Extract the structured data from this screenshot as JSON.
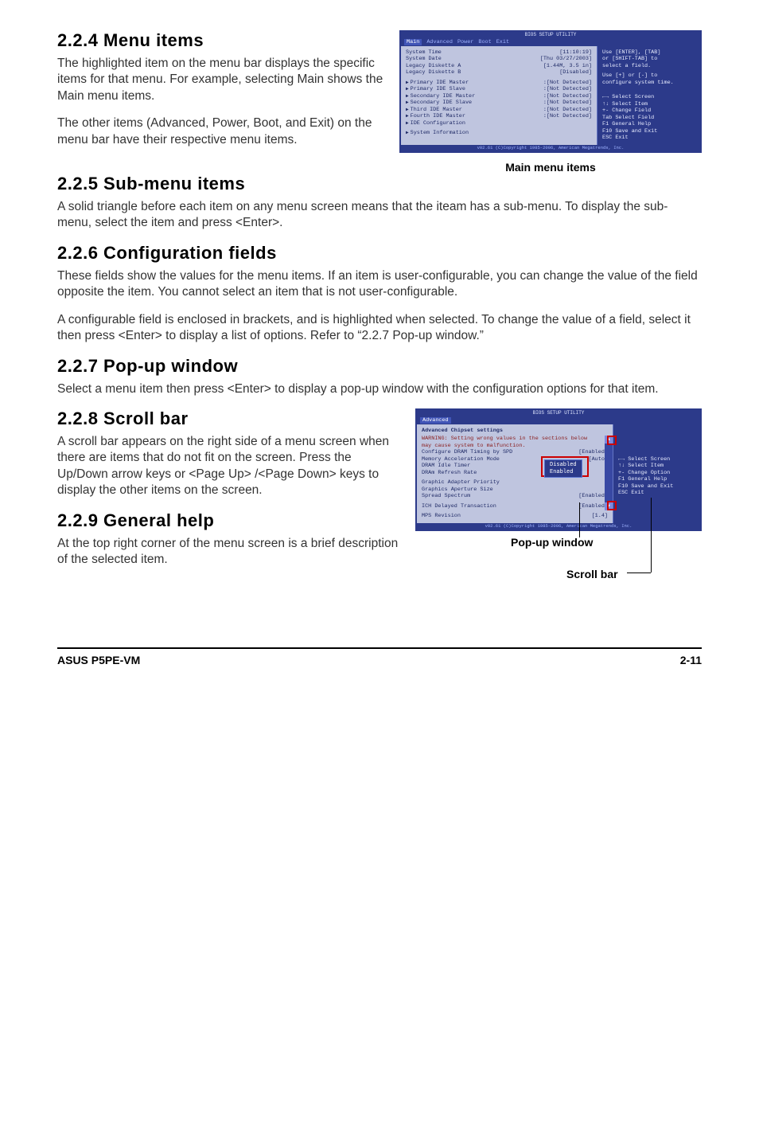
{
  "s224": {
    "title": "2.2.4  Menu items",
    "p1": "The highlighted item on the menu bar displays the specific items for that menu. For example, selecting Main shows the Main menu items.",
    "p2": "The other items (Advanced, Power, Boot, and Exit) on the menu bar have their respective menu items."
  },
  "fig1": {
    "tabs": [
      "Main",
      "Advanced",
      "Power",
      "Boot",
      "Exit"
    ],
    "title": "BIOS SETUP UTILITY",
    "left": [
      {
        "k": "System Time",
        "v": "[11:10:19]"
      },
      {
        "k": "System Date",
        "v": "[Thu 03/27/2003]"
      },
      {
        "k": "Legacy Diskette A",
        "v": "[1.44M, 3.5 in]"
      },
      {
        "k": "Legacy Diskette B",
        "v": "[Disabled]"
      }
    ],
    "left_ide": [
      {
        "k": "Primary IDE Master",
        "v": ":[Not Detected]"
      },
      {
        "k": "Primary IDE Slave",
        "v": ":[Not Detected]"
      },
      {
        "k": "Secondary IDE Master",
        "v": ":[Not Detected]"
      },
      {
        "k": "Secondary IDE Slave",
        "v": ":[Not Detected]"
      },
      {
        "k": "Third IDE Master",
        "v": ":[Not Detected]"
      },
      {
        "k": "Fourth IDE Master",
        "v": ":[Not Detected]"
      },
      {
        "k": "IDE Configuration",
        "v": ""
      }
    ],
    "left_sysinfo": "System Information",
    "right_hint1": "Use [ENTER], [TAB]",
    "right_hint2": "or [SHIFT-TAB] to",
    "right_hint3": "select a field.",
    "right_hint4": "Use [+] or [-] to",
    "right_hint5": "configure system time.",
    "right_keys": [
      "←→   Select Screen",
      "↑↓   Select Item",
      "+-   Change Field",
      "Tab  Select Field",
      "F1   General Help",
      "F10  Save and Exit",
      "ESC  Exit"
    ],
    "bottom": "v02.61 (C)Copyright 1985-2006, American Megatrends, Inc.",
    "caption": "Main menu items"
  },
  "s225": {
    "title": "2.2.5  Sub-menu items",
    "p1": "A solid triangle before each item on any menu screen means that the iteam has a sub-menu. To display the sub-menu, select the item and press <Enter>."
  },
  "s226": {
    "title": "2.2.6  Configuration fields",
    "p1": "These fields show the values for the menu items. If an item is user-configurable, you can change the value of the field opposite the item. You cannot select an item that is not user-configurable.",
    "p2": "A configurable field is enclosed in brackets, and is highlighted when selected. To change the value of a field, select it then press <Enter> to display a list of options. Refer to “2.2.7 Pop-up window.”"
  },
  "s227": {
    "title": "2.2.7  Pop-up window",
    "p1": "Select a menu item then press <Enter> to display a pop-up window with the configuration options for that item."
  },
  "s228": {
    "title": "2.2.8  Scroll bar",
    "p1": "A scroll bar appears on the right side of a menu screen when there are items that do not fit on the screen. Press the Up/Down arrow keys or <Page Up> /<Page Down> keys to display the other items on the screen."
  },
  "fig2": {
    "tab": "Advanced",
    "title": "BIOS SETUP UTILITY",
    "header": "Advanced Chipset settings",
    "warn1": "WARNING: Setting wrong values in the sections below",
    "warn2": "         may cause system to malfunction.",
    "rows": [
      {
        "k": "Configure DRAM Timing by SPD",
        "v": "[Enabled]"
      },
      {
        "k": "Memory Acceleration Mode",
        "v": "[Auto]"
      },
      {
        "k": "DRAM Idle Timer",
        "v": ""
      },
      {
        "k": "DRAm Refresh Rate",
        "v": ""
      },
      {
        "k": "",
        "v": ""
      },
      {
        "k": "Graphic Adapter Priority",
        "v": ""
      },
      {
        "k": "Graphics Aperture Size",
        "v": ""
      },
      {
        "k": "Spread Spectrum",
        "v": "[Enabled]"
      },
      {
        "k": "",
        "v": ""
      },
      {
        "k": "ICH Delayed Transaction",
        "v": "[Enabled]"
      },
      {
        "k": "",
        "v": ""
      },
      {
        "k": "MPS Revision",
        "v": "[1.4]"
      }
    ],
    "popup": [
      "Disabled",
      "Enabled"
    ],
    "right_keys": [
      "←→   Select Screen",
      "↑↓   Select Item",
      "+-   Change Option",
      "F1   General Help",
      "F10  Save and Exit",
      "ESC  Exit"
    ],
    "bottom": "v02.61 (C)Copyright 1985-2006, American Megatrends, Inc.",
    "annot_popup": "Pop-up window",
    "annot_scroll": "Scroll bar"
  },
  "s229": {
    "title": "2.2.9  General help",
    "p1": "At the top right corner of the menu screen is a brief description of the selected item."
  },
  "footer": {
    "left": "ASUS P5PE-VM",
    "right": "2-11"
  }
}
